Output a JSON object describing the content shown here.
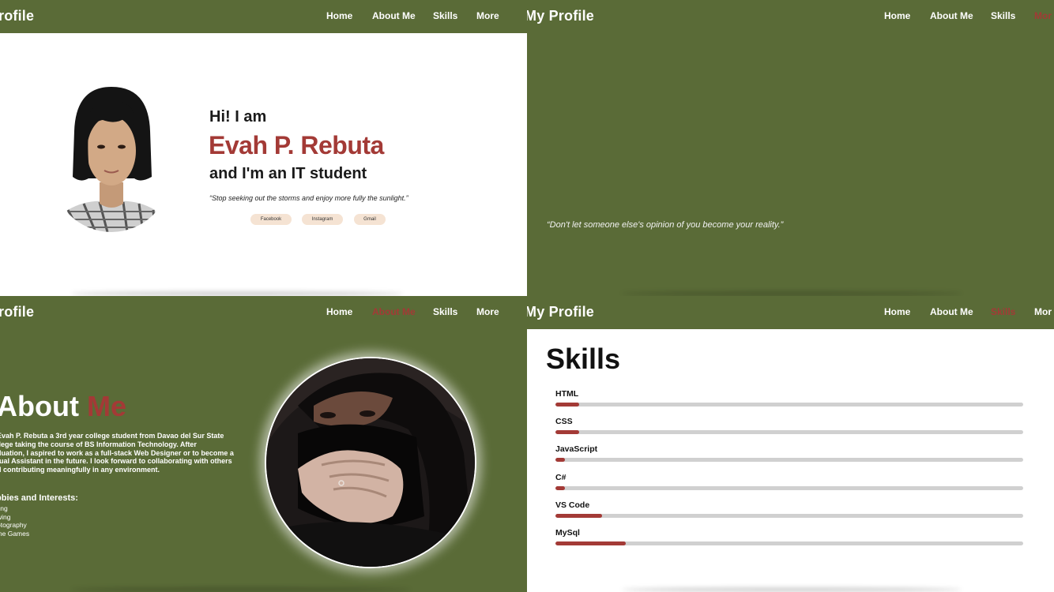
{
  "brand": {
    "left_fragment": "rofile",
    "full": "My Profile",
    "mid_fragment": "rofile"
  },
  "nav": {
    "home": "Home",
    "about": "About Me",
    "skills": "Skills",
    "more": "More",
    "more_clipped": "Mor"
  },
  "colors": {
    "nav_bg": "#5a6b37",
    "accent": "#a33a36",
    "tag_bg": "#f5e3d3",
    "track": "#d0d0d0"
  },
  "hero": {
    "greeting": "Hi! I am",
    "name": "Evah P. Rebuta",
    "role": "and I'm an IT student",
    "quote": "“Stop seeking out the storms and enjoy more fully the sunlight.”",
    "socials": [
      "Facebook",
      "Instagram",
      "Gmail"
    ]
  },
  "panel2": {
    "quote": "“Don't let someone else's opinion of you become your reality.”"
  },
  "about": {
    "title_main": "About",
    "title_accent": "Me",
    "body_lines": [
      "Evah P. Rebuta a 3rd year college student from Davao del Sur State",
      "llege taking the course of BS Information Technology. After",
      "duation, I aspired to work as a full-stack Web Designer or to become a",
      "tual Assistant in the future. I look forward to collaborating with others",
      "d contributing meaningfully in any environment."
    ],
    "hobbies_title": "bbies and Interests:",
    "hobbies": [
      "ting",
      "wing",
      "otography",
      "ine Games"
    ]
  },
  "skills": {
    "title": "Skills",
    "items": [
      {
        "label": "HTML",
        "level": 0.05
      },
      {
        "label": "CSS",
        "level": 0.05
      },
      {
        "label": "JavaScript",
        "level": 0.02
      },
      {
        "label": "C#",
        "level": 0.02
      },
      {
        "label": "VS Code",
        "level": 0.1
      },
      {
        "label": "MySql",
        "level": 0.15
      }
    ]
  }
}
